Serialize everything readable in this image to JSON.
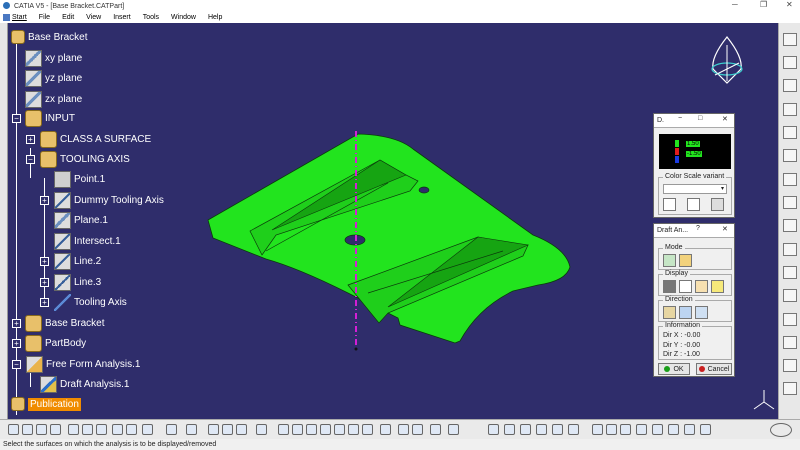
{
  "window": {
    "title": "CATIA V5 - [Base Bracket.CATPart]"
  },
  "menu": {
    "items": [
      "Start",
      "File",
      "Edit",
      "View",
      "Insert",
      "Tools",
      "Window",
      "Help"
    ]
  },
  "tree": {
    "nodes": [
      {
        "label": "Base Bracket",
        "icon": "part-icon"
      },
      {
        "label": "xy plane",
        "icon": "plane-icon"
      },
      {
        "label": "yz plane",
        "icon": "plane-icon"
      },
      {
        "label": "zx plane",
        "icon": "plane-icon"
      },
      {
        "label": "INPUT",
        "icon": "geometrical-set-icon"
      },
      {
        "label": "CLASS A SURFACE",
        "icon": "geometrical-set-icon"
      },
      {
        "label": "TOOLING AXIS",
        "icon": "geometrical-set-icon"
      },
      {
        "label": "Point.1",
        "icon": "point-icon"
      },
      {
        "label": "Dummy Tooling Axis",
        "icon": "line-icon"
      },
      {
        "label": "Plane.1",
        "icon": "plane-icon"
      },
      {
        "label": "Intersect.1",
        "icon": "intersect-icon"
      },
      {
        "label": "Line.2",
        "icon": "line-icon"
      },
      {
        "label": "Line.3",
        "icon": "line-icon"
      },
      {
        "label": "Tooling Axis",
        "icon": "line-icon"
      },
      {
        "label": "Base Bracket",
        "icon": "body-icon"
      },
      {
        "label": "PartBody",
        "icon": "body-icon"
      },
      {
        "label": "Free Form Analysis.1",
        "icon": "analysis-icon"
      },
      {
        "label": "Draft Analysis.1",
        "icon": "draft-analysis-icon"
      },
      {
        "label": "Publication",
        "icon": "publication-icon"
      }
    ]
  },
  "color_scale": {
    "title": "D.",
    "variant_label": "Color Scale variant",
    "variant_value": "",
    "values": [
      "1.50",
      "-1.50"
    ]
  },
  "draft_panel": {
    "title": "Draft An...",
    "help": "?",
    "mode_label": "Mode",
    "display_label": "Display",
    "direction_label": "Direction",
    "information_label": "Information",
    "dir_x": "Dir X : -0.00",
    "dir_y": "Dir Y : -0.00",
    "dir_z": "Dir Z : -1.00",
    "ok": "OK",
    "cancel": "Cancel"
  },
  "status": {
    "text": "Select the surfaces on which the analysis is to be displayed/removed"
  },
  "colors": {
    "background": "#2f2d6b",
    "surface": "#22e41e",
    "axis": "#d31fd6"
  }
}
